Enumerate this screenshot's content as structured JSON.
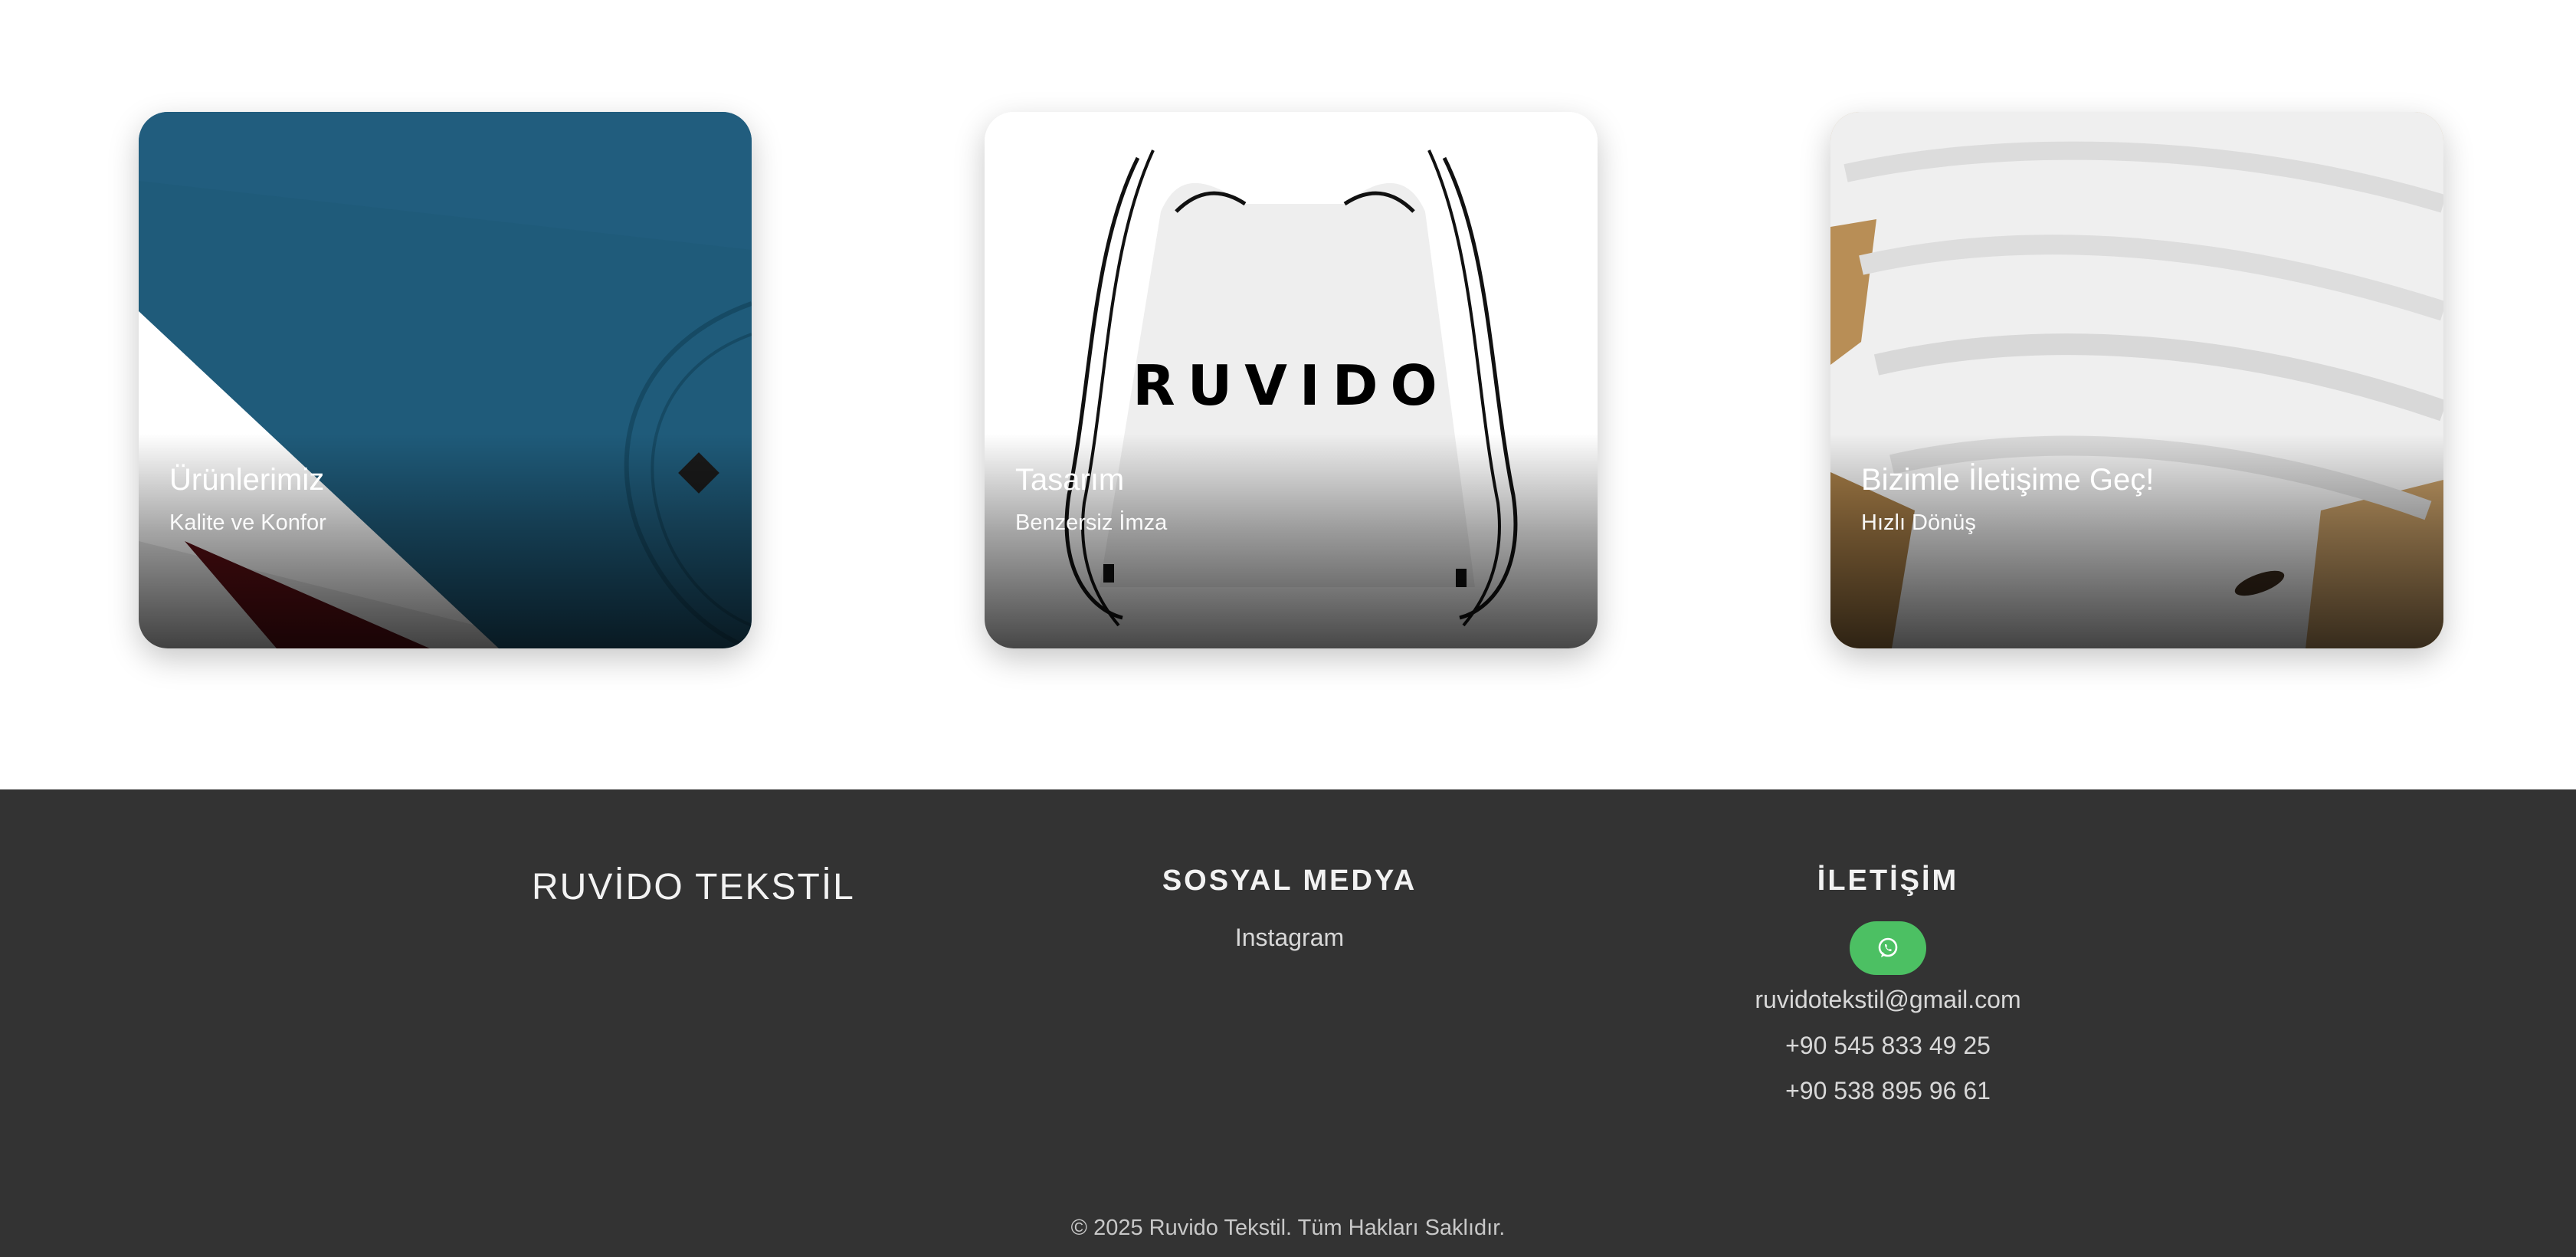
{
  "cards": [
    {
      "title": "Ürünlerimiz",
      "subtitle": "Kalite ve Konfor",
      "image": "folded-blue-tshirt"
    },
    {
      "title": "Tasarım",
      "subtitle": "Benzersiz İmza",
      "image": "white-drawstring-bag",
      "bag_print": "RUVIDO"
    },
    {
      "title": "Bizimle İletişime Geç!",
      "subtitle": "Hızlı Dönüş",
      "image": "stacked-white-towels"
    }
  ],
  "footer": {
    "brand": "RUVİDO TEKSTİL",
    "social": {
      "heading": "SOSYAL MEDYA",
      "links": [
        "Instagram"
      ]
    },
    "contact": {
      "heading": "İLETİŞİM",
      "whatsapp_icon": "whatsapp-icon",
      "email": "ruvidotekstil@gmail.com",
      "phones": [
        "+90 545 833 49 25",
        "+90 538 895 96 61"
      ]
    },
    "copyright": "© 2025 Ruvido Tekstil. Tüm Hakları Saklıdır."
  },
  "colors": {
    "footer_bg": "#333333",
    "whatsapp": "#4cc063"
  }
}
